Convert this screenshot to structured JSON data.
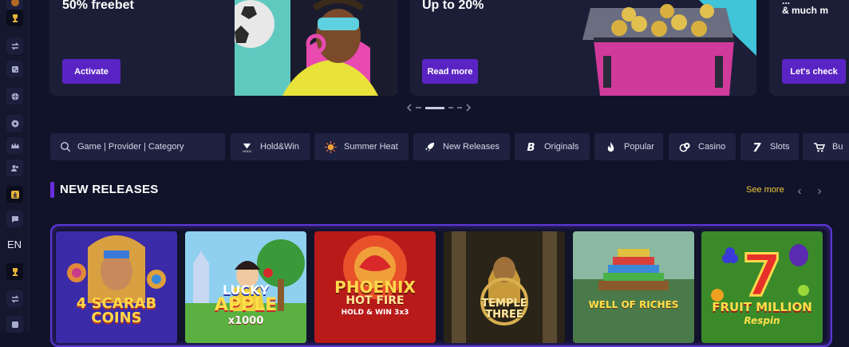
{
  "rail": {
    "language": "EN",
    "icons": [
      "trophy-icon",
      "swap-icon",
      "cube-icon",
      "ball-icon",
      "football-icon",
      "crown-icon",
      "users-icon",
      "download-icon",
      "chat-icon",
      "trophy-icon",
      "swap-icon"
    ]
  },
  "banners": [
    {
      "title": "50% freebet",
      "button": "Activate"
    },
    {
      "title": "Up to 20%",
      "button": "Read more"
    },
    {
      "title_line1": "...",
      "title_line2": "& much m",
      "button": "Let's check"
    }
  ],
  "search": {
    "placeholder": "Game | Provider | Category"
  },
  "chips": [
    {
      "label": "Hold&Win",
      "icon": "holdwin-icon"
    },
    {
      "label": "Summer Heat",
      "icon": "sun-icon"
    },
    {
      "label": "New Releases",
      "icon": "rocket-icon"
    },
    {
      "label": "Originals",
      "icon": "b-logo-icon"
    },
    {
      "label": "Popular",
      "icon": "flame-icon"
    },
    {
      "label": "Casino",
      "icon": "chips-icon"
    },
    {
      "label": "Slots",
      "icon": "seven-icon"
    },
    {
      "label": "Bu",
      "icon": "cart-icon"
    }
  ],
  "section": {
    "title": "NEW RELEASES",
    "see_more": "See more"
  },
  "games": [
    {
      "line1": "4 SCARAB",
      "line2": "COINS"
    },
    {
      "line1": "LUCKY",
      "line2": "APPLE",
      "line3": "x1000"
    },
    {
      "line1": "PHOENIX",
      "line2": "HOT FIRE",
      "line3": "HOLD & WIN 3x3"
    },
    {
      "line1": "TEMPLE",
      "line2": "THREE"
    },
    {
      "line1": "WELL OF RICHES"
    },
    {
      "line1": "FRUIT MILLION",
      "line2": "Respin"
    }
  ],
  "colors": {
    "accent": "#5a24c4",
    "background": "#11132a",
    "panel": "#1e2140",
    "see_more": "#f0c93a"
  }
}
